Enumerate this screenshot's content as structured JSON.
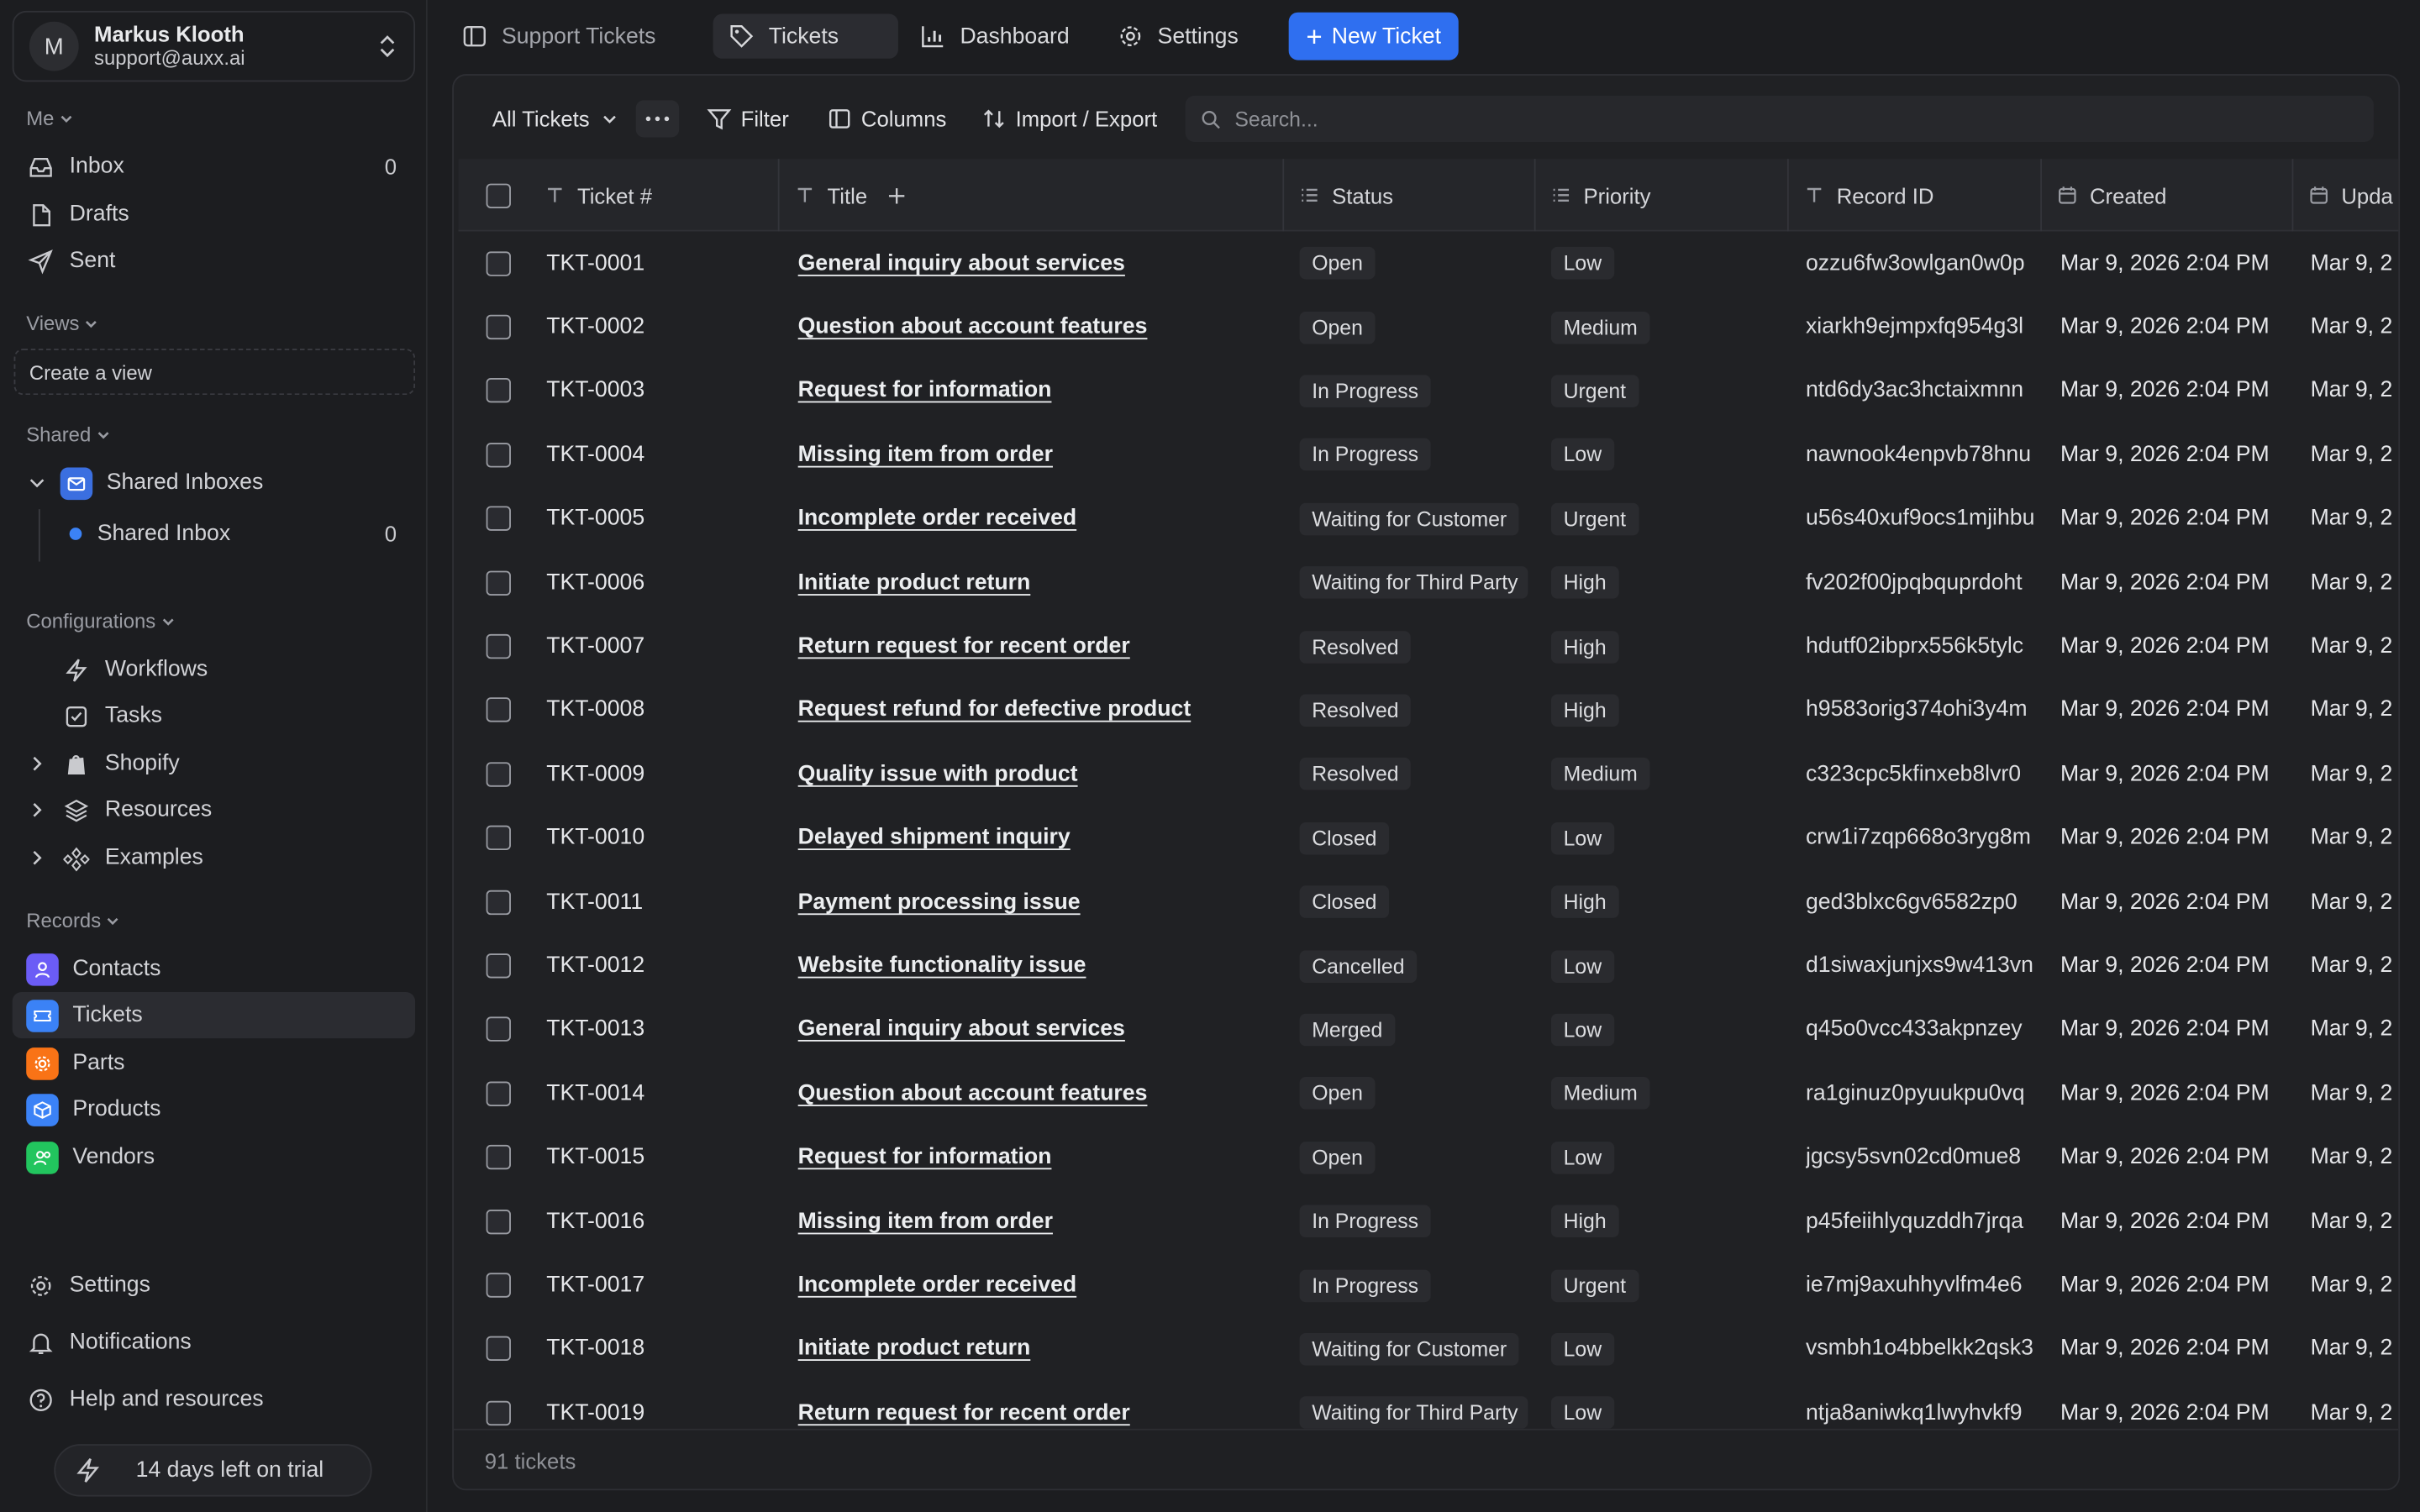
{
  "user": {
    "initial": "M",
    "name": "Markus Klooth",
    "email": "support@auxx.ai"
  },
  "sidebar": {
    "me_label": "Me",
    "me_items": [
      {
        "label": "Inbox",
        "count": "0",
        "icon": "inbox-icon"
      },
      {
        "label": "Drafts",
        "icon": "file-icon"
      },
      {
        "label": "Sent",
        "icon": "send-icon"
      }
    ],
    "views_label": "Views",
    "create_view": "Create a view",
    "shared_label": "Shared",
    "shared_inboxes": "Shared Inboxes",
    "shared_inbox": {
      "label": "Shared Inbox",
      "count": "0"
    },
    "config_label": "Configurations",
    "config_items": [
      {
        "label": "Workflows",
        "icon": "zap-icon"
      },
      {
        "label": "Tasks",
        "icon": "checkbox-icon"
      },
      {
        "label": "Shopify",
        "icon": "shopify-icon"
      },
      {
        "label": "Resources",
        "icon": "layers-icon"
      },
      {
        "label": "Examples",
        "icon": "shapes-icon"
      }
    ],
    "records_label": "Records",
    "records": [
      {
        "label": "Contacts",
        "color": "#6b5cf6"
      },
      {
        "label": "Tickets",
        "color": "#3b82f6"
      },
      {
        "label": "Parts",
        "color": "#f97316"
      },
      {
        "label": "Products",
        "color": "#3b82f6"
      },
      {
        "label": "Vendors",
        "color": "#22c55e"
      }
    ],
    "bottom": {
      "settings": "Settings",
      "notifications": "Notifications",
      "help": "Help and resources"
    },
    "trial": "14 days left on trial"
  },
  "topbar": {
    "breadcrumb": "Support Tickets",
    "tabs": {
      "tickets": "Tickets",
      "dashboard": "Dashboard",
      "settings": "Settings"
    },
    "new_ticket": "New Ticket"
  },
  "toolbar": {
    "view": "All Tickets",
    "filter": "Filter",
    "columns": "Columns",
    "import_export": "Import / Export",
    "search_placeholder": "Search..."
  },
  "table": {
    "headers": {
      "ticket": "Ticket #",
      "title": "Title",
      "status": "Status",
      "priority": "Priority",
      "record": "Record ID",
      "created": "Created",
      "updated": "Upda"
    },
    "rows": [
      [
        "TKT-0001",
        "General inquiry about services",
        "Open",
        "Low",
        "ozzu6fw3owlgan0w0p",
        "Mar 9, 2026 2:04 PM",
        "Mar 9, 2"
      ],
      [
        "TKT-0002",
        "Question about account features",
        "Open",
        "Medium",
        "xiarkh9ejmpxfq954g3l",
        "Mar 9, 2026 2:04 PM",
        "Mar 9, 2"
      ],
      [
        "TKT-0003",
        "Request for information",
        "In Progress",
        "Urgent",
        "ntd6dy3ac3hctaixmnn",
        "Mar 9, 2026 2:04 PM",
        "Mar 9, 2"
      ],
      [
        "TKT-0004",
        "Missing item from order",
        "In Progress",
        "Low",
        "nawnook4enpvb78hnu",
        "Mar 9, 2026 2:04 PM",
        "Mar 9, 2"
      ],
      [
        "TKT-0005",
        "Incomplete order received",
        "Waiting for Customer",
        "Urgent",
        "u56s40xuf9ocs1mjihbu",
        "Mar 9, 2026 2:04 PM",
        "Mar 9, 2"
      ],
      [
        "TKT-0006",
        "Initiate product return",
        "Waiting for Third Party",
        "High",
        "fv202f00jpqbquprdoht",
        "Mar 9, 2026 2:04 PM",
        "Mar 9, 2"
      ],
      [
        "TKT-0007",
        "Return request for recent order",
        "Resolved",
        "High",
        "hdutf02ibprx556k5tylc",
        "Mar 9, 2026 2:04 PM",
        "Mar 9, 2"
      ],
      [
        "TKT-0008",
        "Request refund for defective product",
        "Resolved",
        "High",
        "h9583orig374ohi3y4m",
        "Mar 9, 2026 2:04 PM",
        "Mar 9, 2"
      ],
      [
        "TKT-0009",
        "Quality issue with product",
        "Resolved",
        "Medium",
        "c323cpc5kfinxeb8lvr0",
        "Mar 9, 2026 2:04 PM",
        "Mar 9, 2"
      ],
      [
        "TKT-0010",
        "Delayed shipment inquiry",
        "Closed",
        "Low",
        "crw1i7zqp668o3ryg8m",
        "Mar 9, 2026 2:04 PM",
        "Mar 9, 2"
      ],
      [
        "TKT-0011",
        "Payment processing issue",
        "Closed",
        "High",
        "ged3blxc6gv6582zp0",
        "Mar 9, 2026 2:04 PM",
        "Mar 9, 2"
      ],
      [
        "TKT-0012",
        "Website functionality issue",
        "Cancelled",
        "Low",
        "d1siwaxjunjxs9w413vn",
        "Mar 9, 2026 2:04 PM",
        "Mar 9, 2"
      ],
      [
        "TKT-0013",
        "General inquiry about services",
        "Merged",
        "Low",
        "q45o0vcc433akpnzey",
        "Mar 9, 2026 2:04 PM",
        "Mar 9, 2"
      ],
      [
        "TKT-0014",
        "Question about account features",
        "Open",
        "Medium",
        "ra1ginuz0pyuukpu0vq",
        "Mar 9, 2026 2:04 PM",
        "Mar 9, 2"
      ],
      [
        "TKT-0015",
        "Request for information",
        "Open",
        "Low",
        "jgcsy5svn02cd0mue8",
        "Mar 9, 2026 2:04 PM",
        "Mar 9, 2"
      ],
      [
        "TKT-0016",
        "Missing item from order",
        "In Progress",
        "High",
        "p45feiihlyquzddh7jrqa",
        "Mar 9, 2026 2:04 PM",
        "Mar 9, 2"
      ],
      [
        "TKT-0017",
        "Incomplete order received",
        "In Progress",
        "Urgent",
        "ie7mj9axuhhyvlfm4e6",
        "Mar 9, 2026 2:04 PM",
        "Mar 9, 2"
      ],
      [
        "TKT-0018",
        "Initiate product return",
        "Waiting for Customer",
        "Low",
        "vsmbh1o4bbelkk2qsk3",
        "Mar 9, 2026 2:04 PM",
        "Mar 9, 2"
      ],
      [
        "TKT-0019",
        "Return request for recent order",
        "Waiting for Third Party",
        "Low",
        "ntja8aniwkq1lwyhvkf9",
        "Mar 9, 2026 2:04 PM",
        "Mar 9, 2"
      ]
    ],
    "footer": "91 tickets"
  }
}
